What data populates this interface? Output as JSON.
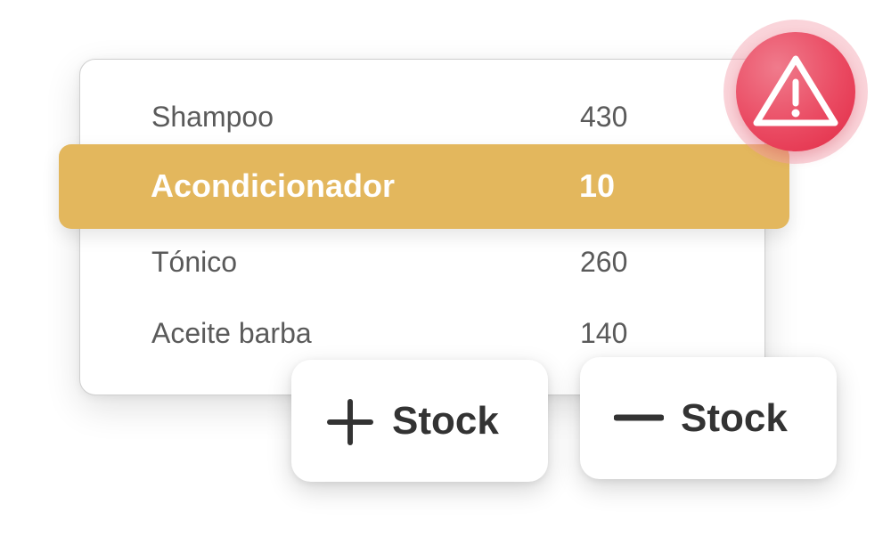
{
  "colors": {
    "highlight": "#e3b75d",
    "alert": "#e8405a",
    "text": "#5a5a5a",
    "button_text": "#333333"
  },
  "inventory": {
    "items": [
      {
        "name": "Shampoo",
        "qty": "430"
      },
      {
        "name": "Acondicionador",
        "qty": "10",
        "low_stock": true
      },
      {
        "name": "Tónico",
        "qty": "260"
      },
      {
        "name": "Aceite barba",
        "qty": "140"
      }
    ]
  },
  "alert": {
    "icon": "warning-triangle-icon"
  },
  "actions": {
    "add_stock": {
      "icon": "plus-icon",
      "label": "Stock"
    },
    "remove_stock": {
      "icon": "minus-icon",
      "label": "Stock"
    }
  }
}
